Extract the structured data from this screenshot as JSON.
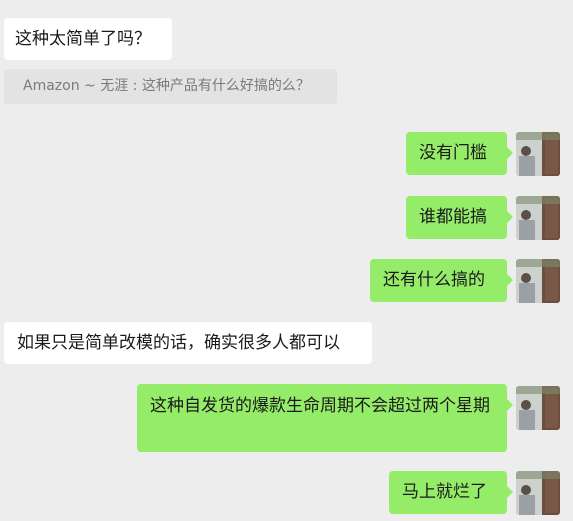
{
  "messages": [
    {
      "side": "left",
      "text": "这种太简单了吗？"
    },
    {
      "side": "quote",
      "text": "Amazon ~ 无涯 : 这种产品有什么好搞的么？"
    },
    {
      "side": "right",
      "text": "没有门槛"
    },
    {
      "side": "right",
      "text": "谁都能搞"
    },
    {
      "side": "right",
      "text": "还有什么搞的"
    },
    {
      "side": "left",
      "text": "如果只是简单改模的话，确实很多人都可以"
    },
    {
      "side": "right",
      "text": "这种自发货的爆款生命周期不会超过两个星期"
    },
    {
      "side": "right",
      "text": "马上就烂了"
    }
  ],
  "colors": {
    "background": "#ededed",
    "sent_bubble": "#95ec69",
    "received_bubble": "#ffffff",
    "quote_background": "#e3e3e3"
  }
}
